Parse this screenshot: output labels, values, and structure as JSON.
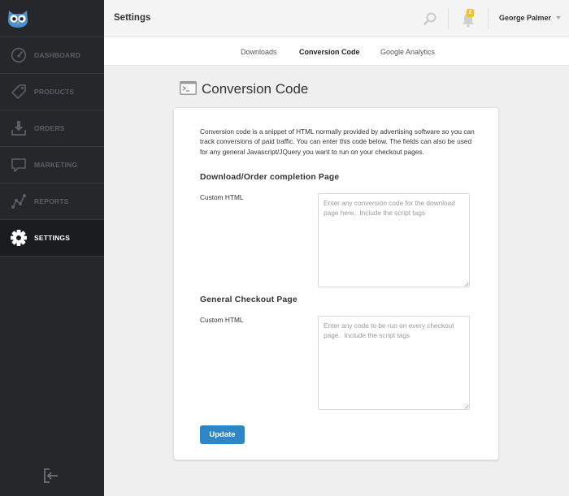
{
  "sidebar": {
    "logo_icon": "owl-logo-icon",
    "items": [
      {
        "label": "DASHBOARD",
        "icon": "speedometer-icon"
      },
      {
        "label": "PRODUCTS",
        "icon": "price-tag-icon"
      },
      {
        "label": "ORDERS",
        "icon": "download-tray-icon"
      },
      {
        "label": "MARKETING",
        "icon": "speech-bubble-icon"
      },
      {
        "label": "REPORTS",
        "icon": "line-graph-icon"
      },
      {
        "label": "SETTINGS",
        "icon": "gear-icon",
        "active": true
      }
    ],
    "logout_icon": "logout-icon"
  },
  "header": {
    "title": "Settings",
    "search_icon": "search-icon",
    "notifications_icon": "bell-icon",
    "notifications_count": "2",
    "user_name": "George Palmer"
  },
  "tabs": [
    {
      "label": "Downloads",
      "active": false
    },
    {
      "label": "Conversion Code",
      "active": true
    },
    {
      "label": "Google Analytics",
      "active": false
    }
  ],
  "main": {
    "section_icon": "terminal-icon",
    "section_title": "Conversion Code",
    "intro": "Conversion code is a snippet of HTML normally provided by advertising software so you can track conversions of paid traffic. You can enter this code below. The fields can also be used for any general Javascript/JQuery you want to run on your checkout pages.",
    "download_section": {
      "heading": "Download/Order completion Page",
      "field_label": "Custom HTML",
      "value": "",
      "placeholder": "Enter any conversion code for the download page here.  Include the script tags"
    },
    "checkout_section": {
      "heading": "General Checkout Page",
      "field_label": "Custom HTML",
      "value": "",
      "placeholder": "Enter any code to be run on every checkout page.  Include the script tags"
    },
    "update_label": "Update"
  },
  "colors": {
    "sidebar_bg": "#25272b",
    "sidebar_active_bg": "#191b1e",
    "accent_blue": "#2f86c6",
    "badge_yellow": "#f0c419"
  }
}
